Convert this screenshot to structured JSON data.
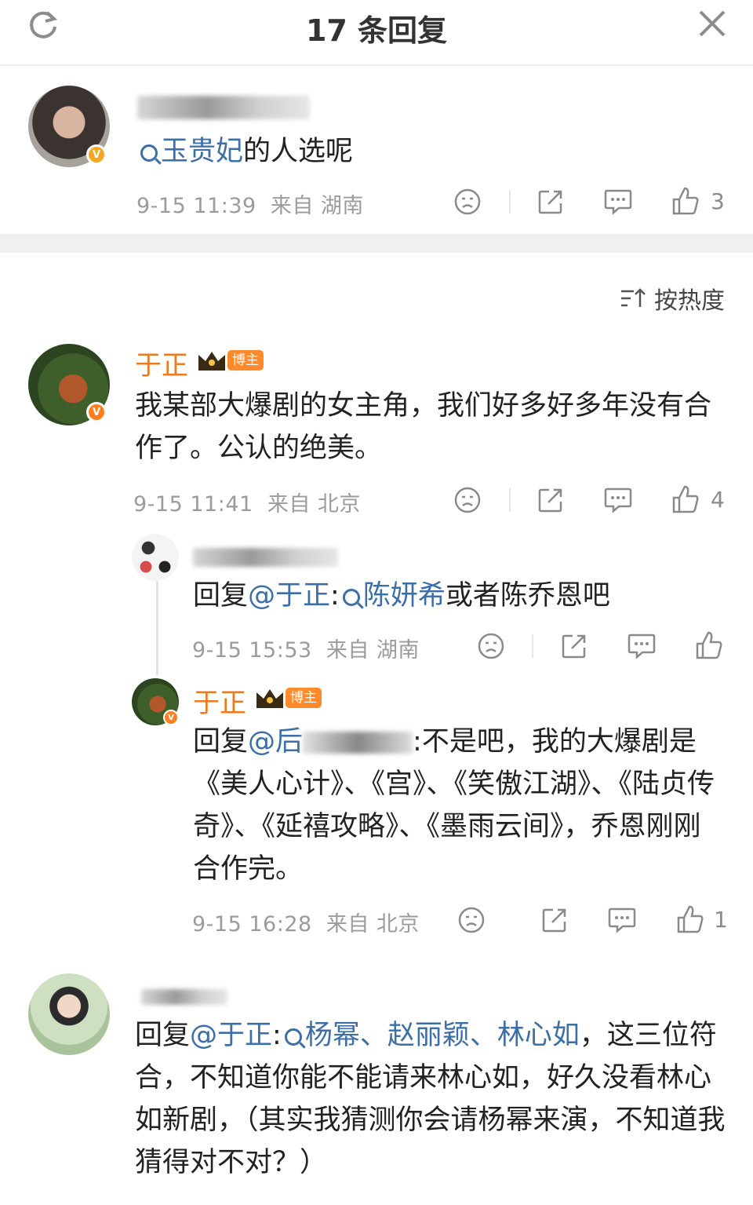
{
  "header": {
    "title": "17 条回复"
  },
  "root_comment": {
    "text_prefix": "",
    "link_text": "玉贵妃",
    "text_rest": "的人选呢",
    "time": "9-15 11:39",
    "location": "来自 湖南",
    "likes": "3"
  },
  "sort": {
    "label": "按热度"
  },
  "comments": [
    {
      "name": "于正",
      "badge": "博主",
      "text": "我某部大爆剧的女主角，我们好多好多年没有合作了。公认的绝美。",
      "time": "9-15 11:41",
      "location": "来自 北京",
      "likes": "4"
    },
    {
      "reply_prefix": "回复",
      "mention": "@于正",
      "colon": ":",
      "link_text": "陈妍希",
      "text_rest": "或者陈乔恩吧",
      "time": "9-15 15:53",
      "location": "来自 湖南"
    },
    {
      "name": "于正",
      "badge": "博主",
      "reply_prefix": "回复",
      "mention": "@后",
      "text_rest": ":不是吧，我的大爆剧是《美人心计》、《宫》、《笑傲江湖》、《陆贞传奇》、《延禧攻略》、《墨雨云间》，乔恩刚刚合作完。",
      "time": "9-15 16:28",
      "location": "来自 北京",
      "likes": "1"
    },
    {
      "reply_prefix": "回复",
      "mention": "@于正",
      "colon": ":",
      "link_1": "杨幂",
      "sep_1": "、",
      "link_2": "赵丽颖",
      "sep_2": "、",
      "link_3": "林心如",
      "text_rest": "，这三位符合，不知道你能不能请来林心如，好久没看林心如新剧，（其实我猜测你会请杨幂来演，不知道我猜得对不对？）"
    }
  ],
  "colors": {
    "name": "#f0781e",
    "link": "#3c6ea8",
    "meta": "#9b9b9b",
    "badge": "#ff8a2b"
  },
  "icons": [
    "refresh-icon",
    "close-icon",
    "search-icon",
    "dislike-icon",
    "share-icon",
    "comment-icon",
    "like-icon",
    "sort-icon"
  ]
}
